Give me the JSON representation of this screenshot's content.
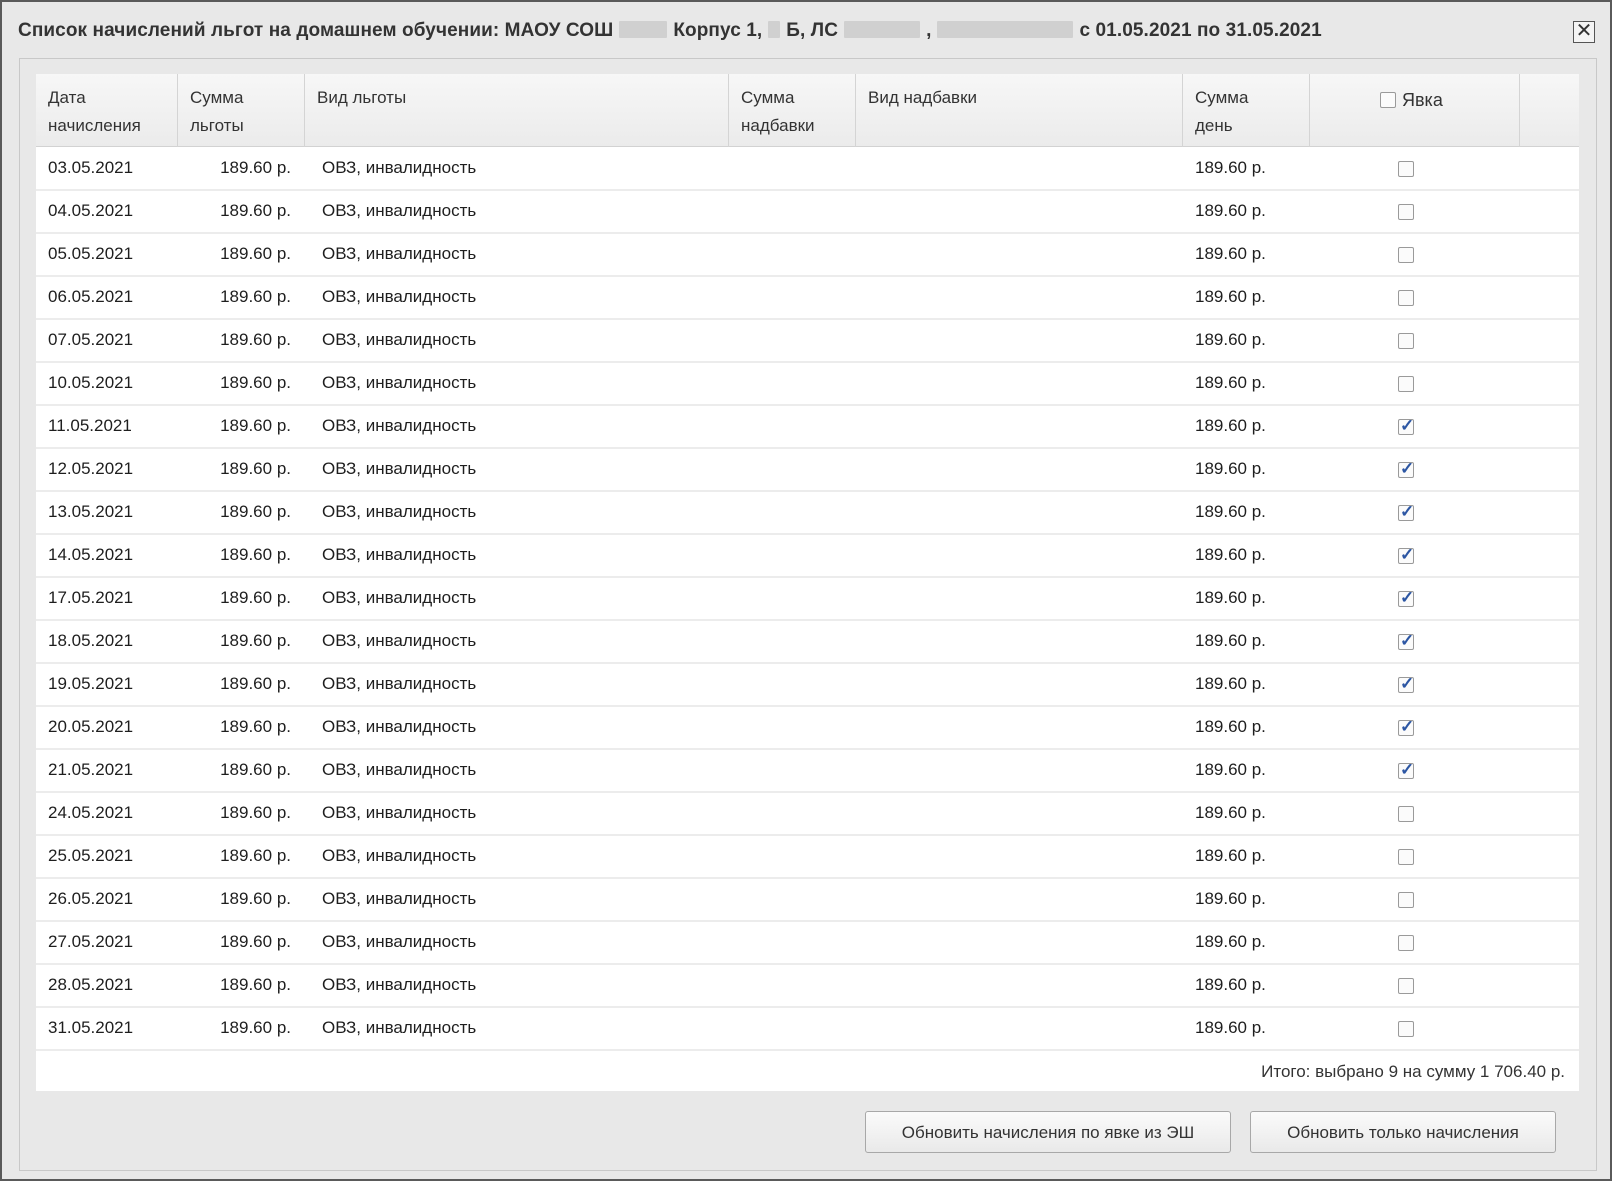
{
  "dialog": {
    "title_parts": [
      "Список начислений льгот на домашнем обучении: МАОУ СОШ",
      "Корпус 1,",
      "Б, ЛС",
      ",",
      "с 01.05.2021 по 31.05.2021"
    ],
    "close_glyph": "✕"
  },
  "columns": [
    {
      "line1": "Дата",
      "line2": "начисления"
    },
    {
      "line1": "Сумма",
      "line2": "льготы"
    },
    {
      "line1": "Вид льготы",
      "line2": ""
    },
    {
      "line1": "Сумма",
      "line2": "надбавки"
    },
    {
      "line1": "Вид надбавки",
      "line2": ""
    },
    {
      "line1": "Сумма",
      "line2": "день"
    },
    {
      "line1": "Явка",
      "line2": ""
    }
  ],
  "header_checkbox_checked": false,
  "rows": [
    {
      "date": "03.05.2021",
      "sum": "189.60 р.",
      "vid": "ОВЗ, инвалидность",
      "nadb_sum": "",
      "nadb_vid": "",
      "day": "189.60 р.",
      "checked": false
    },
    {
      "date": "04.05.2021",
      "sum": "189.60 р.",
      "vid": "ОВЗ, инвалидность",
      "nadb_sum": "",
      "nadb_vid": "",
      "day": "189.60 р.",
      "checked": false
    },
    {
      "date": "05.05.2021",
      "sum": "189.60 р.",
      "vid": "ОВЗ, инвалидность",
      "nadb_sum": "",
      "nadb_vid": "",
      "day": "189.60 р.",
      "checked": false
    },
    {
      "date": "06.05.2021",
      "sum": "189.60 р.",
      "vid": "ОВЗ, инвалидность",
      "nadb_sum": "",
      "nadb_vid": "",
      "day": "189.60 р.",
      "checked": false
    },
    {
      "date": "07.05.2021",
      "sum": "189.60 р.",
      "vid": "ОВЗ, инвалидность",
      "nadb_sum": "",
      "nadb_vid": "",
      "day": "189.60 р.",
      "checked": false
    },
    {
      "date": "10.05.2021",
      "sum": "189.60 р.",
      "vid": "ОВЗ, инвалидность",
      "nadb_sum": "",
      "nadb_vid": "",
      "day": "189.60 р.",
      "checked": false
    },
    {
      "date": "11.05.2021",
      "sum": "189.60 р.",
      "vid": "ОВЗ, инвалидность",
      "nadb_sum": "",
      "nadb_vid": "",
      "day": "189.60 р.",
      "checked": true
    },
    {
      "date": "12.05.2021",
      "sum": "189.60 р.",
      "vid": "ОВЗ, инвалидность",
      "nadb_sum": "",
      "nadb_vid": "",
      "day": "189.60 р.",
      "checked": true
    },
    {
      "date": "13.05.2021",
      "sum": "189.60 р.",
      "vid": "ОВЗ, инвалидность",
      "nadb_sum": "",
      "nadb_vid": "",
      "day": "189.60 р.",
      "checked": true
    },
    {
      "date": "14.05.2021",
      "sum": "189.60 р.",
      "vid": "ОВЗ, инвалидность",
      "nadb_sum": "",
      "nadb_vid": "",
      "day": "189.60 р.",
      "checked": true
    },
    {
      "date": "17.05.2021",
      "sum": "189.60 р.",
      "vid": "ОВЗ, инвалидность",
      "nadb_sum": "",
      "nadb_vid": "",
      "day": "189.60 р.",
      "checked": true
    },
    {
      "date": "18.05.2021",
      "sum": "189.60 р.",
      "vid": "ОВЗ, инвалидность",
      "nadb_sum": "",
      "nadb_vid": "",
      "day": "189.60 р.",
      "checked": true
    },
    {
      "date": "19.05.2021",
      "sum": "189.60 р.",
      "vid": "ОВЗ, инвалидность",
      "nadb_sum": "",
      "nadb_vid": "",
      "day": "189.60 р.",
      "checked": true
    },
    {
      "date": "20.05.2021",
      "sum": "189.60 р.",
      "vid": "ОВЗ, инвалидность",
      "nadb_sum": "",
      "nadb_vid": "",
      "day": "189.60 р.",
      "checked": true
    },
    {
      "date": "21.05.2021",
      "sum": "189.60 р.",
      "vid": "ОВЗ, инвалидность",
      "nadb_sum": "",
      "nadb_vid": "",
      "day": "189.60 р.",
      "checked": true
    },
    {
      "date": "24.05.2021",
      "sum": "189.60 р.",
      "vid": "ОВЗ, инвалидность",
      "nadb_sum": "",
      "nadb_vid": "",
      "day": "189.60 р.",
      "checked": false
    },
    {
      "date": "25.05.2021",
      "sum": "189.60 р.",
      "vid": "ОВЗ, инвалидность",
      "nadb_sum": "",
      "nadb_vid": "",
      "day": "189.60 р.",
      "checked": false
    },
    {
      "date": "26.05.2021",
      "sum": "189.60 р.",
      "vid": "ОВЗ, инвалидность",
      "nadb_sum": "",
      "nadb_vid": "",
      "day": "189.60 р.",
      "checked": false
    },
    {
      "date": "27.05.2021",
      "sum": "189.60 р.",
      "vid": "ОВЗ, инвалидность",
      "nadb_sum": "",
      "nadb_vid": "",
      "day": "189.60 р.",
      "checked": false
    },
    {
      "date": "28.05.2021",
      "sum": "189.60 р.",
      "vid": "ОВЗ, инвалидность",
      "nadb_sum": "",
      "nadb_vid": "",
      "day": "189.60 р.",
      "checked": false
    },
    {
      "date": "31.05.2021",
      "sum": "189.60 р.",
      "vid": "ОВЗ, инвалидность",
      "nadb_sum": "",
      "nadb_vid": "",
      "day": "189.60 р.",
      "checked": false
    }
  ],
  "total_text": "Итого: выбрано 9 на сумму 1 706.40 р.",
  "buttons": {
    "update_by_attendance": "Обновить начисления по явке из ЭШ",
    "update_only": "Обновить только начисления"
  }
}
